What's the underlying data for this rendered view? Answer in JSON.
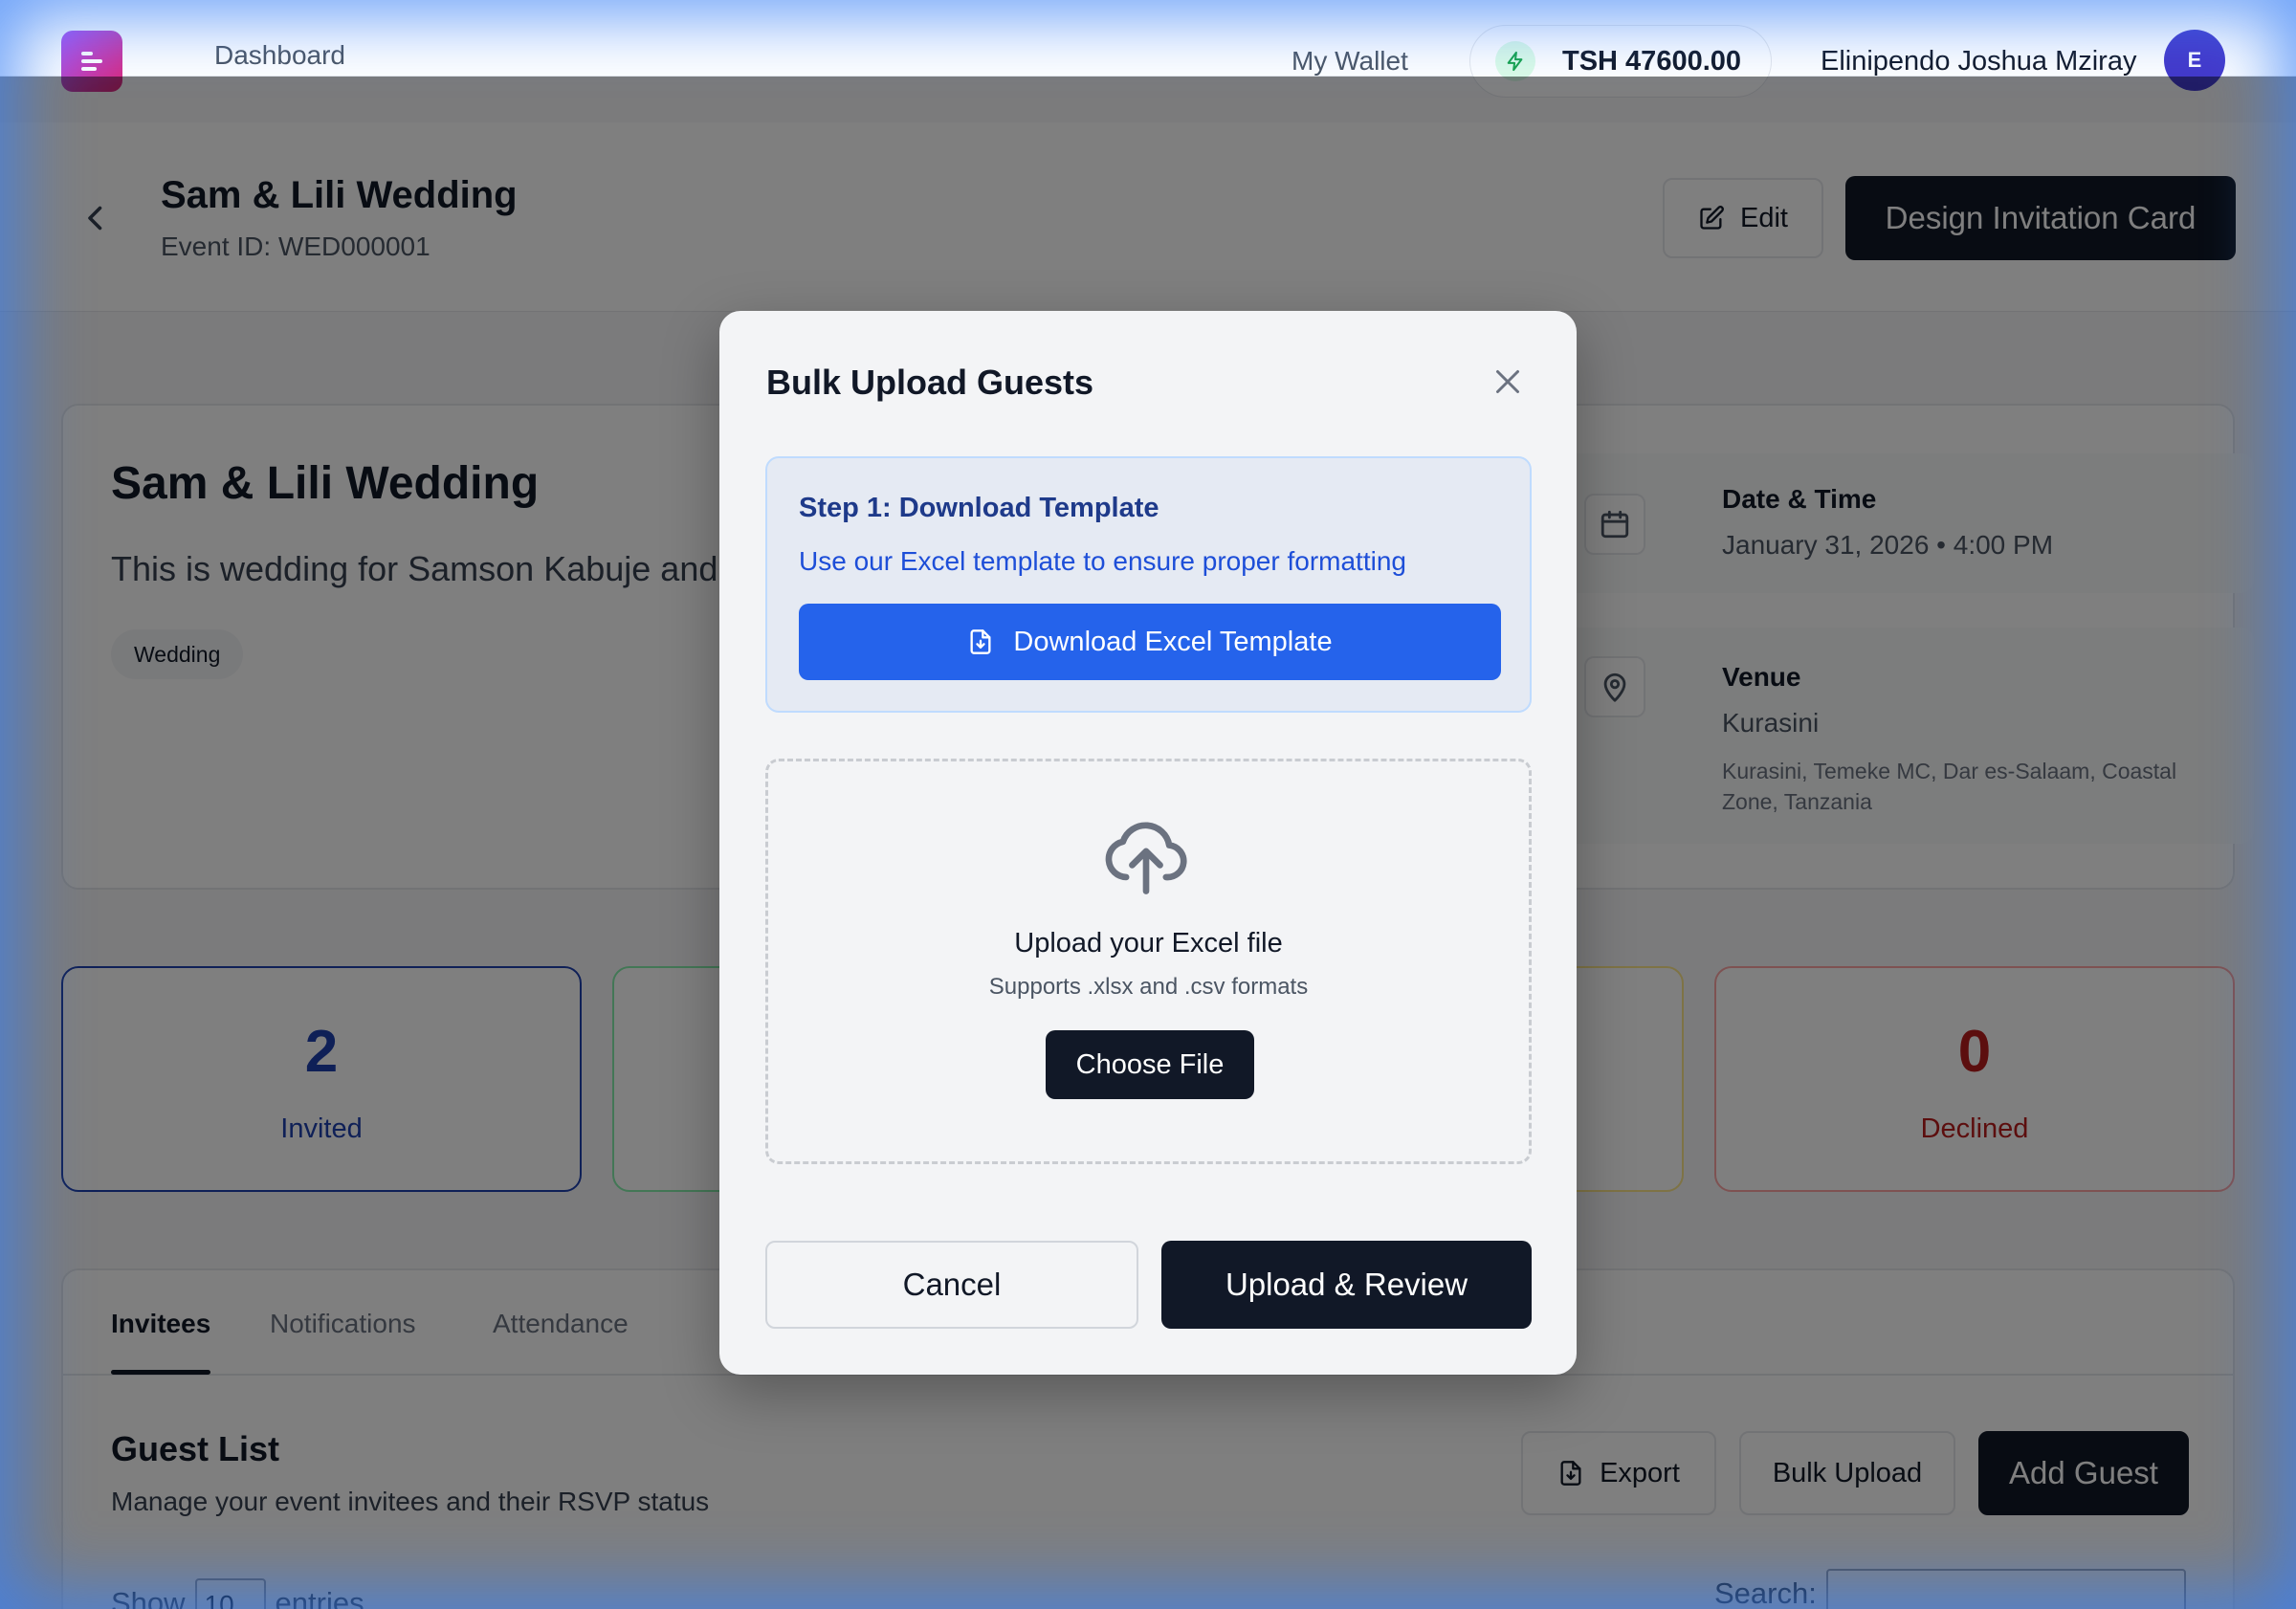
{
  "nav": {
    "dashboard": "Dashboard",
    "wallet": "My Wallet",
    "balance": "TSH 47600.00",
    "user_name": "Elinipendo Joshua Mziray",
    "avatar_initial": "E"
  },
  "event": {
    "title": "Sam & Lili Wedding",
    "event_id": "Event ID: WED000001",
    "edit_label": "Edit",
    "design_label": "Design Invitation Card",
    "description": "This is wedding for Samson Kabuje and",
    "tag": "Wedding",
    "date_label": "Date & Time",
    "date_value": "January 31, 2026 • 4:00 PM",
    "venue_label": "Venue",
    "venue_name": "Kurasini",
    "venue_address": "Kurasini, Temeke MC, Dar es-Salaam, Coastal Zone, Tanzania"
  },
  "stats": [
    {
      "value": "2",
      "label": "Invited",
      "color": "#1e40af",
      "border": "#1e40af"
    },
    {
      "value": "",
      "label": "",
      "color": "#16a34a",
      "border": "#86efac"
    },
    {
      "value": "",
      "label": "",
      "color": "#ca8a04",
      "border": "#fde68a"
    },
    {
      "value": "0",
      "label": "Declined",
      "color": "#b91c1c",
      "border": "#fca5a5"
    }
  ],
  "tabs": [
    "Invitees",
    "Notifications",
    "Attendance"
  ],
  "guest_list": {
    "title": "Guest List",
    "subtitle": "Manage your event invitees and their RSVP status",
    "export_label": "Export",
    "bulk_label": "Bulk Upload",
    "add_label": "Add Guest",
    "show_label": "Show",
    "entries_value": "10",
    "entries_label": "entries",
    "search_label": "Search:"
  },
  "modal": {
    "title": "Bulk Upload Guests",
    "step_title": "Step 1: Download Template",
    "step_desc": "Use our Excel template to ensure proper formatting",
    "download_label": "Download Excel Template",
    "drop_title": "Upload your Excel file",
    "drop_sub": "Supports .xlsx and .csv formats",
    "choose_label": "Choose File",
    "cancel_label": "Cancel",
    "upload_label": "Upload & Review"
  },
  "icons": {
    "logo": "menu-logo-icon",
    "balance": "bolt-icon",
    "back": "chevron-left-icon",
    "edit": "edit-icon",
    "calendar": "calendar-icon",
    "venue": "map-pin-icon",
    "export": "file-download-icon",
    "close": "close-icon",
    "download": "file-download-icon",
    "upload": "cloud-upload-icon"
  },
  "colors": {
    "accent": "#2563eb",
    "dark": "#111827"
  }
}
